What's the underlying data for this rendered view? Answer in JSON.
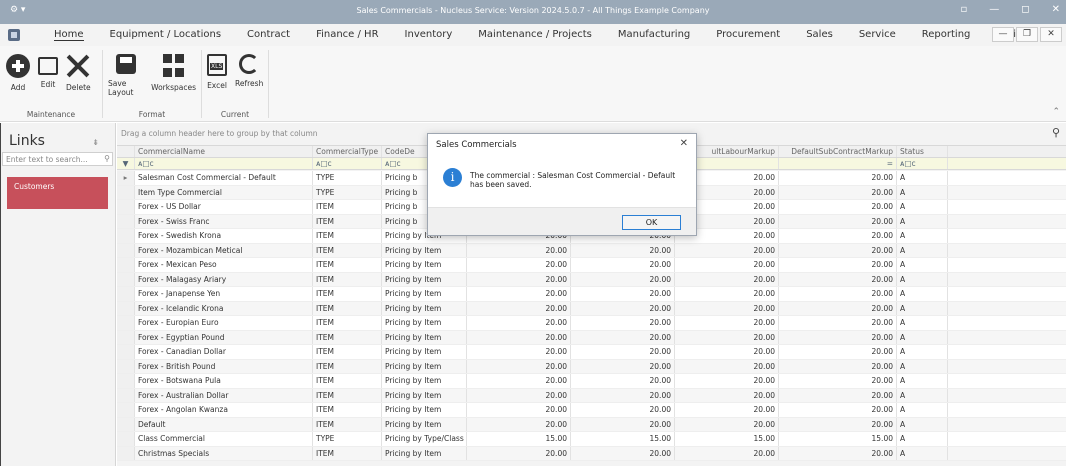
{
  "window": {
    "title": "Sales Commercials - Nucleus Service: Version 2024.5.0.7 - All Things Example Company",
    "system_menu": "⚙ ▾",
    "controls": [
      "▫",
      "—",
      "◻",
      "✕"
    ]
  },
  "menu": {
    "items": [
      "Home",
      "Equipment / Locations",
      "Contract",
      "Finance / HR",
      "Inventory",
      "Maintenance / Projects",
      "Manufacturing",
      "Procurement",
      "Sales",
      "Service",
      "Reporting",
      "Utilities"
    ],
    "active": "Home",
    "right_controls": [
      "—",
      "❐",
      "✕"
    ]
  },
  "ribbon": {
    "groups": [
      {
        "label": "Maintenance",
        "buttons": [
          {
            "label": "Add",
            "icon": "add-icon"
          },
          {
            "label": "Edit",
            "icon": "edit-icon"
          },
          {
            "label": "Delete",
            "icon": "delete-icon"
          }
        ]
      },
      {
        "label": "Format",
        "buttons": [
          {
            "label": "Save Layout",
            "icon": "save-layout-icon"
          },
          {
            "label": "Workspaces",
            "icon": "workspaces-icon"
          }
        ]
      },
      {
        "label": "Current",
        "buttons": [
          {
            "label": "Excel",
            "icon": "excel-icon"
          },
          {
            "label": "Refresh",
            "icon": "refresh-icon"
          }
        ]
      }
    ]
  },
  "links": {
    "title": "Links",
    "search_placeholder": "Enter text to search...",
    "items": [
      "Customers"
    ]
  },
  "grid": {
    "group_hint": "Drag a column header here to group by that column",
    "columns": [
      "CommercialName",
      "CommercialType",
      "CodeDe",
      "",
      "",
      "ultLabourMarkup",
      "DefaultSubContractMarkup",
      "Status"
    ],
    "filter_row": [
      "ᴀ□c",
      "ᴀ□c",
      "ᴀ□c",
      "",
      "",
      "",
      "=",
      "ᴀ□c"
    ],
    "rows": [
      [
        "Salesman Cost Commercial - Default",
        "TYPE",
        "Pricing b",
        "",
        "",
        "20.00",
        "20.00",
        "A"
      ],
      [
        "Item Type Commercial",
        "TYPE",
        "Pricing b",
        "",
        "",
        "20.00",
        "20.00",
        "A"
      ],
      [
        "Forex - US Dollar",
        "ITEM",
        "Pricing b",
        "",
        "",
        "20.00",
        "20.00",
        "A"
      ],
      [
        "Forex - Swiss Franc",
        "ITEM",
        "Pricing b",
        "",
        "",
        "20.00",
        "20.00",
        "A"
      ],
      [
        "Forex - Swedish Krona",
        "ITEM",
        "Pricing by Item",
        "20.00",
        "20.00",
        "20.00",
        "20.00",
        "A"
      ],
      [
        "Forex - Mozambican Metical",
        "ITEM",
        "Pricing by Item",
        "20.00",
        "20.00",
        "20.00",
        "20.00",
        "A"
      ],
      [
        "Forex - Mexican Peso",
        "ITEM",
        "Pricing by Item",
        "20.00",
        "20.00",
        "20.00",
        "20.00",
        "A"
      ],
      [
        "Forex - Malagasy Ariary",
        "ITEM",
        "Pricing by Item",
        "20.00",
        "20.00",
        "20.00",
        "20.00",
        "A"
      ],
      [
        "Forex - Janapense Yen",
        "ITEM",
        "Pricing by Item",
        "20.00",
        "20.00",
        "20.00",
        "20.00",
        "A"
      ],
      [
        "Forex - Icelandic Krona",
        "ITEM",
        "Pricing by Item",
        "20.00",
        "20.00",
        "20.00",
        "20.00",
        "A"
      ],
      [
        "Forex - Europian Euro",
        "ITEM",
        "Pricing by Item",
        "20.00",
        "20.00",
        "20.00",
        "20.00",
        "A"
      ],
      [
        "Forex - Egyptian Pound",
        "ITEM",
        "Pricing by Item",
        "20.00",
        "20.00",
        "20.00",
        "20.00",
        "A"
      ],
      [
        "Forex - Canadian Dollar",
        "ITEM",
        "Pricing by Item",
        "20.00",
        "20.00",
        "20.00",
        "20.00",
        "A"
      ],
      [
        "Forex - British Pound",
        "ITEM",
        "Pricing by Item",
        "20.00",
        "20.00",
        "20.00",
        "20.00",
        "A"
      ],
      [
        "Forex - Botswana Pula",
        "ITEM",
        "Pricing by Item",
        "20.00",
        "20.00",
        "20.00",
        "20.00",
        "A"
      ],
      [
        "Forex - Australian Dollar",
        "ITEM",
        "Pricing by Item",
        "20.00",
        "20.00",
        "20.00",
        "20.00",
        "A"
      ],
      [
        "Forex - Angolan Kwanza",
        "ITEM",
        "Pricing by Item",
        "20.00",
        "20.00",
        "20.00",
        "20.00",
        "A"
      ],
      [
        "Default",
        "ITEM",
        "Pricing by Item",
        "20.00",
        "20.00",
        "20.00",
        "20.00",
        "A"
      ],
      [
        "Class Commercial",
        "TYPE",
        "Pricing by Type/Class",
        "15.00",
        "15.00",
        "15.00",
        "15.00",
        "A"
      ],
      [
        "Christmas Specials",
        "ITEM",
        "Pricing by Item",
        "20.00",
        "20.00",
        "20.00",
        "20.00",
        "A"
      ]
    ]
  },
  "dialog": {
    "title": "Sales Commercials",
    "message": "The commercial : Salesman Cost Commercial - Default has been saved.",
    "ok_label": "OK",
    "close": "✕",
    "info_glyph": "i"
  },
  "colors": {
    "titlebar": "#9aa9b8",
    "link_tile": "#c7505b",
    "info_icon": "#2b7fd4"
  }
}
